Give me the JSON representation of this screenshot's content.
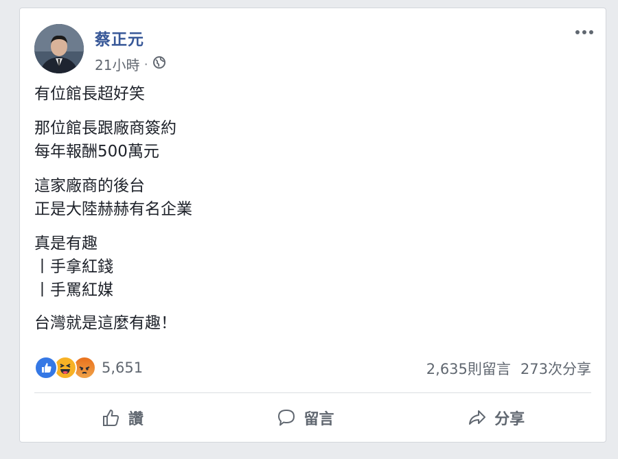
{
  "post": {
    "author": "蔡正元",
    "timestamp": "21小時",
    "separator": "·",
    "privacy_icon": "globe-icon",
    "paragraphs": [
      "有位館長超好笑",
      "那位館長跟廠商簽約\n每年報酬500萬元",
      "這家廠商的後台\n正是大陸赫赫有名企業",
      "真是有趣\n丨手拿紅錢\n丨手罵紅媒",
      "台灣就是這麼有趣！"
    ]
  },
  "engagement": {
    "reaction_icons": [
      "like-icon",
      "haha-icon",
      "angry-icon"
    ],
    "reaction_count": "5,651",
    "comments": "2,635則留言",
    "shares": "273次分享"
  },
  "actions": {
    "like_label": "讚",
    "comment_label": "留言",
    "share_label": "分享"
  },
  "colors": {
    "author": "#385898",
    "like_blue": "#3578e5",
    "haha_yellow": "#f7b125",
    "angry_orange": "#e9711c"
  }
}
